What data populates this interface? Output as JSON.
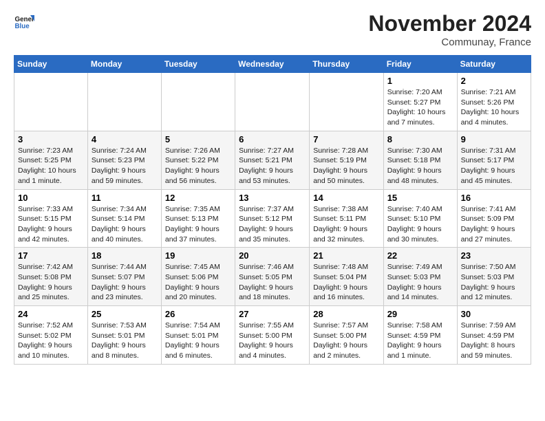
{
  "logo": {
    "line1": "General",
    "line2": "Blue"
  },
  "title": "November 2024",
  "location": "Communay, France",
  "headers": [
    "Sunday",
    "Monday",
    "Tuesday",
    "Wednesday",
    "Thursday",
    "Friday",
    "Saturday"
  ],
  "rows": [
    [
      {
        "day": "",
        "info": ""
      },
      {
        "day": "",
        "info": ""
      },
      {
        "day": "",
        "info": ""
      },
      {
        "day": "",
        "info": ""
      },
      {
        "day": "",
        "info": ""
      },
      {
        "day": "1",
        "info": "Sunrise: 7:20 AM\nSunset: 5:27 PM\nDaylight: 10 hours\nand 7 minutes."
      },
      {
        "day": "2",
        "info": "Sunrise: 7:21 AM\nSunset: 5:26 PM\nDaylight: 10 hours\nand 4 minutes."
      }
    ],
    [
      {
        "day": "3",
        "info": "Sunrise: 7:23 AM\nSunset: 5:25 PM\nDaylight: 10 hours\nand 1 minute."
      },
      {
        "day": "4",
        "info": "Sunrise: 7:24 AM\nSunset: 5:23 PM\nDaylight: 9 hours\nand 59 minutes."
      },
      {
        "day": "5",
        "info": "Sunrise: 7:26 AM\nSunset: 5:22 PM\nDaylight: 9 hours\nand 56 minutes."
      },
      {
        "day": "6",
        "info": "Sunrise: 7:27 AM\nSunset: 5:21 PM\nDaylight: 9 hours\nand 53 minutes."
      },
      {
        "day": "7",
        "info": "Sunrise: 7:28 AM\nSunset: 5:19 PM\nDaylight: 9 hours\nand 50 minutes."
      },
      {
        "day": "8",
        "info": "Sunrise: 7:30 AM\nSunset: 5:18 PM\nDaylight: 9 hours\nand 48 minutes."
      },
      {
        "day": "9",
        "info": "Sunrise: 7:31 AM\nSunset: 5:17 PM\nDaylight: 9 hours\nand 45 minutes."
      }
    ],
    [
      {
        "day": "10",
        "info": "Sunrise: 7:33 AM\nSunset: 5:15 PM\nDaylight: 9 hours\nand 42 minutes."
      },
      {
        "day": "11",
        "info": "Sunrise: 7:34 AM\nSunset: 5:14 PM\nDaylight: 9 hours\nand 40 minutes."
      },
      {
        "day": "12",
        "info": "Sunrise: 7:35 AM\nSunset: 5:13 PM\nDaylight: 9 hours\nand 37 minutes."
      },
      {
        "day": "13",
        "info": "Sunrise: 7:37 AM\nSunset: 5:12 PM\nDaylight: 9 hours\nand 35 minutes."
      },
      {
        "day": "14",
        "info": "Sunrise: 7:38 AM\nSunset: 5:11 PM\nDaylight: 9 hours\nand 32 minutes."
      },
      {
        "day": "15",
        "info": "Sunrise: 7:40 AM\nSunset: 5:10 PM\nDaylight: 9 hours\nand 30 minutes."
      },
      {
        "day": "16",
        "info": "Sunrise: 7:41 AM\nSunset: 5:09 PM\nDaylight: 9 hours\nand 27 minutes."
      }
    ],
    [
      {
        "day": "17",
        "info": "Sunrise: 7:42 AM\nSunset: 5:08 PM\nDaylight: 9 hours\nand 25 minutes."
      },
      {
        "day": "18",
        "info": "Sunrise: 7:44 AM\nSunset: 5:07 PM\nDaylight: 9 hours\nand 23 minutes."
      },
      {
        "day": "19",
        "info": "Sunrise: 7:45 AM\nSunset: 5:06 PM\nDaylight: 9 hours\nand 20 minutes."
      },
      {
        "day": "20",
        "info": "Sunrise: 7:46 AM\nSunset: 5:05 PM\nDaylight: 9 hours\nand 18 minutes."
      },
      {
        "day": "21",
        "info": "Sunrise: 7:48 AM\nSunset: 5:04 PM\nDaylight: 9 hours\nand 16 minutes."
      },
      {
        "day": "22",
        "info": "Sunrise: 7:49 AM\nSunset: 5:03 PM\nDaylight: 9 hours\nand 14 minutes."
      },
      {
        "day": "23",
        "info": "Sunrise: 7:50 AM\nSunset: 5:03 PM\nDaylight: 9 hours\nand 12 minutes."
      }
    ],
    [
      {
        "day": "24",
        "info": "Sunrise: 7:52 AM\nSunset: 5:02 PM\nDaylight: 9 hours\nand 10 minutes."
      },
      {
        "day": "25",
        "info": "Sunrise: 7:53 AM\nSunset: 5:01 PM\nDaylight: 9 hours\nand 8 minutes."
      },
      {
        "day": "26",
        "info": "Sunrise: 7:54 AM\nSunset: 5:01 PM\nDaylight: 9 hours\nand 6 minutes."
      },
      {
        "day": "27",
        "info": "Sunrise: 7:55 AM\nSunset: 5:00 PM\nDaylight: 9 hours\nand 4 minutes."
      },
      {
        "day": "28",
        "info": "Sunrise: 7:57 AM\nSunset: 5:00 PM\nDaylight: 9 hours\nand 2 minutes."
      },
      {
        "day": "29",
        "info": "Sunrise: 7:58 AM\nSunset: 4:59 PM\nDaylight: 9 hours\nand 1 minute."
      },
      {
        "day": "30",
        "info": "Sunrise: 7:59 AM\nSunset: 4:59 PM\nDaylight: 8 hours\nand 59 minutes."
      }
    ]
  ]
}
